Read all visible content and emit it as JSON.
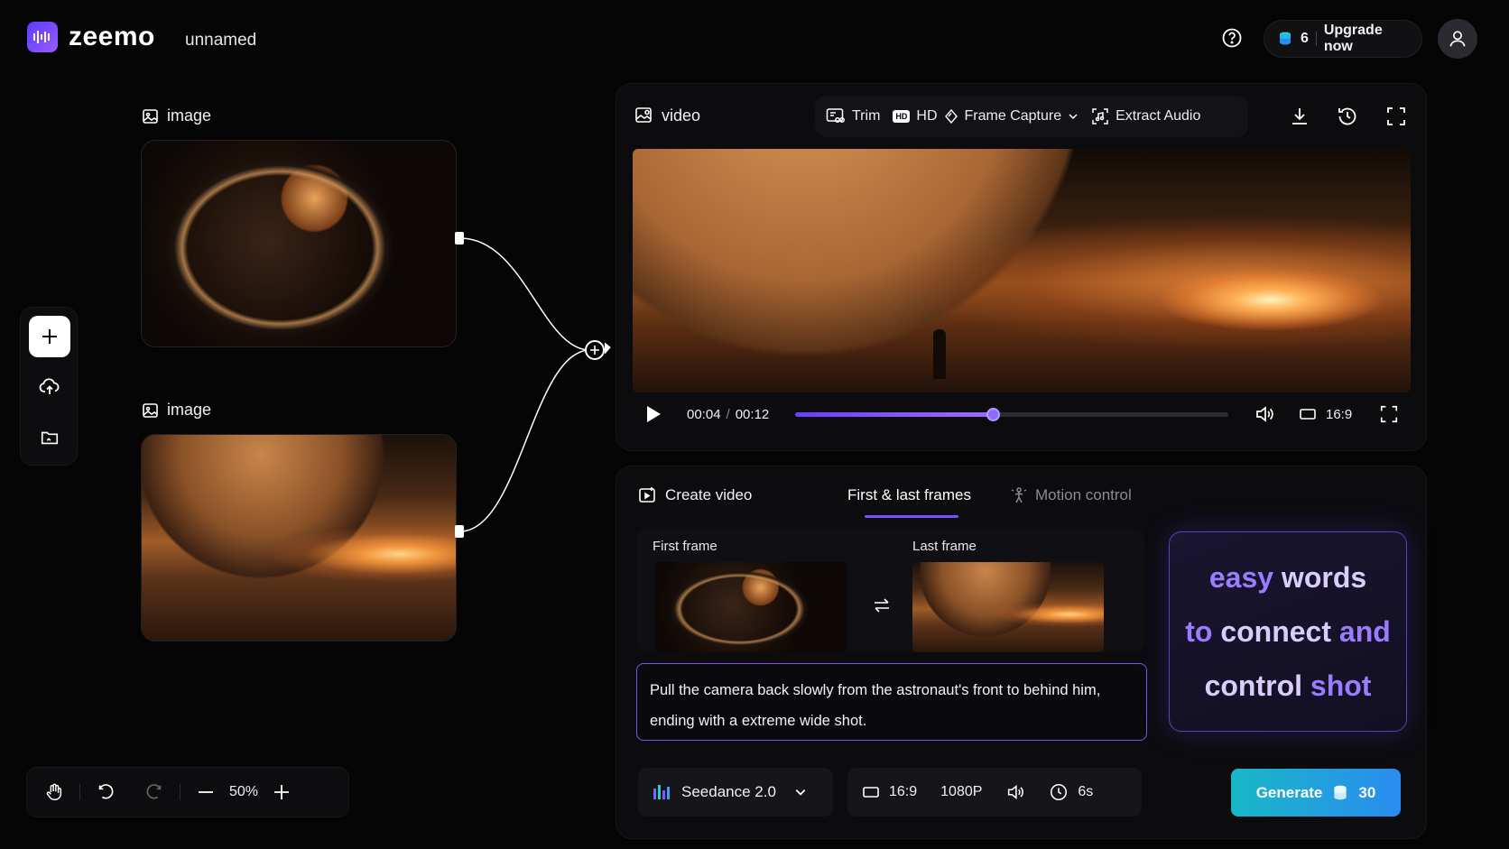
{
  "app": {
    "brand": "zeemo",
    "project_name": "unnamed"
  },
  "header": {
    "credits": "6",
    "upgrade_label": "Upgrade now"
  },
  "canvas": {
    "nodes": [
      {
        "label": "image"
      },
      {
        "label": "image"
      }
    ]
  },
  "video_panel": {
    "title": "video",
    "tools": {
      "trim": "Trim",
      "hd": "HD",
      "frame_capture": "Frame Capture",
      "extract_audio": "Extract Audio"
    },
    "player": {
      "current_time": "00:04",
      "total_time": "00:12",
      "progress": 0.4556,
      "aspect": "16:9"
    }
  },
  "create_panel": {
    "tabs": {
      "create_video": "Create video",
      "first_last": "First & last frames",
      "motion_control": "Motion control"
    },
    "first_frame_label": "First frame",
    "last_frame_label": "Last frame",
    "prompt": "Pull the camera back slowly from the astronaut's front to behind him, ending with a extreme wide shot.",
    "callout": {
      "line1a": "easy",
      "line1b": "words",
      "line2a": "to",
      "line2b": "connect",
      "line2c": "and",
      "line3a": "control",
      "line3b": "shot"
    },
    "model": "Seedance 2.0",
    "settings": {
      "aspect": "16:9",
      "resolution": "1080P",
      "duration": "6s"
    },
    "generate_label": "Generate",
    "generate_cost": "30"
  },
  "zoom": {
    "level": "50%"
  },
  "colors": {
    "accent": "#7c4dff",
    "generate_start": "#19b7c7",
    "generate_end": "#2a8cf0"
  }
}
